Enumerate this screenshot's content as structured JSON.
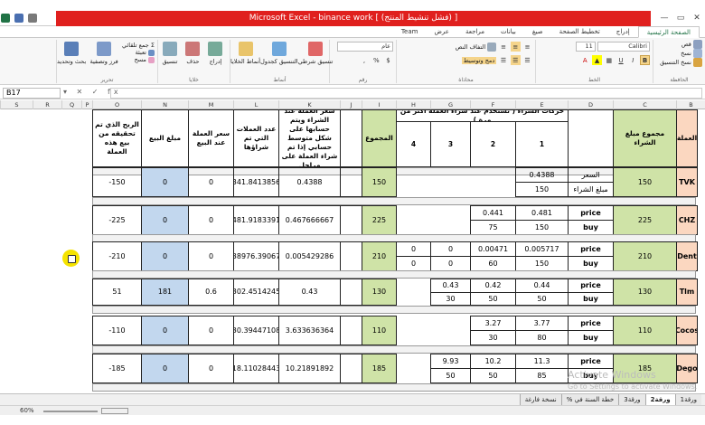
{
  "window": {
    "title": "Microsoft Excel - binance work  [ (فشل تنشيط المنتج) ]",
    "buttons": [
      "—",
      "▭",
      "✕"
    ]
  },
  "ribbon_tabs": [
    "الصفحة الرئيسية",
    "إدراج",
    "تخطيط الصفحة",
    "صيغ",
    "بيانات",
    "مراجعة",
    "عرض",
    "Team"
  ],
  "ribbon": {
    "clipboard": {
      "cut": "قص",
      "copy": "نسخ",
      "paste_format": "نسخ التنسيق",
      "label": "الحافظة"
    },
    "font": {
      "name": "Calibri",
      "size": "11",
      "bold": "B",
      "italic": "I",
      "underline": "U",
      "label": "الخط"
    },
    "alignment": {
      "wrap": "التفاف النص",
      "merge": "دمج وتوسيط",
      "label": "محاذاة"
    },
    "number": {
      "format": "عام",
      "label": "رقم"
    },
    "styles": {
      "conditional": "تنسيق شرطي",
      "as_table": "التنسيق كجدول",
      "cell_styles": "أنماط الخلايا",
      "label": "أنماط"
    },
    "cells": {
      "insert": "إدراج",
      "delete": "حذف",
      "format": "تنسيق",
      "label": "خلايا"
    },
    "editing": {
      "autosum": "جمع تلقائي",
      "fill": "تعبئة",
      "clear": "مسح",
      "sort": "فرز وتصفية",
      "find": "بحث وتحديد",
      "label": "تحرير"
    }
  },
  "formula_bar": {
    "name_box": "B17",
    "icons": "▾  ✕ ✓ fx",
    "formula": ""
  },
  "columns": [
    "B",
    "C",
    "D",
    "E",
    "F",
    "G",
    "H",
    "I",
    "J",
    "K",
    "L",
    "M",
    "N",
    "O",
    "P",
    "Q",
    "R",
    "S"
  ],
  "headers": {
    "currency": "العملة",
    "total_buy": "مجموع مبلغ الشراء",
    "movements": "حركات الشراء ( تستخدم عند شراء العملة أكثر من مرة )",
    "m1": "1",
    "m2": "2",
    "m3": "3",
    "m4": "4",
    "total": "المجموع",
    "avg_price": "سعر العملة عند الشراء ويتم حسابها على شكل متوسط حسابي إذا تم شراء العملة على مراحل",
    "coins": "عدد العملات التي تم شراؤها",
    "sell_price": "سعر العملة عند البيع",
    "sell_amount": "مبلغ البيع",
    "profit": "الربح الذي تم تحقيقه من بيع هذه العملة"
  },
  "rows": [
    {
      "name": "TVK",
      "total_buy": "150",
      "label_top": "السعر",
      "label_bottom": "مبلغ الشراء",
      "m1": [
        "0.4388",
        "150"
      ],
      "m2": [
        "",
        ""
      ],
      "m3": [
        "",
        ""
      ],
      "m4": [
        "",
        ""
      ],
      "sum": "150",
      "avg": "0.4388",
      "coins": "341.8413856",
      "sell_price": "0",
      "sell_amount": "0",
      "profit": "-150"
    },
    {
      "name": "CHZ",
      "total_buy": "225",
      "label_top": "price",
      "label_bottom": "buy",
      "m1": [
        "0.481",
        "150"
      ],
      "m2": [
        "0.441",
        "75"
      ],
      "m3": [
        "",
        ""
      ],
      "m4": [
        "",
        ""
      ],
      "sum": "225",
      "avg": "0.467666667",
      "coins": "481.9183391",
      "sell_price": "0",
      "sell_amount": "0",
      "profit": "-225"
    },
    {
      "name": "Dent",
      "total_buy": "210",
      "label_top": "price",
      "label_bottom": "buy",
      "m1": [
        "0.005717",
        "150"
      ],
      "m2": [
        "0.00471",
        "60"
      ],
      "m3": [
        "0",
        "0"
      ],
      "m4": [
        "0",
        "0"
      ],
      "sum": "210",
      "avg": "0.005429286",
      "coins": "38976.39067",
      "sell_price": "0",
      "sell_amount": "0",
      "profit": "-210"
    },
    {
      "name": "Tlm",
      "total_buy": "130",
      "label_top": "price",
      "label_bottom": "buy",
      "m1": [
        "0.44",
        "50"
      ],
      "m2": [
        "0.42",
        "50"
      ],
      "m3": [
        "0.43",
        "30"
      ],
      "m4": [
        "",
        ""
      ],
      "sum": "130",
      "avg": "0.43",
      "coins": "302.4514245",
      "sell_price": "0.6",
      "sell_amount": "181",
      "profit": "51"
    },
    {
      "name": "Cocos",
      "total_buy": "110",
      "label_top": "price",
      "label_bottom": "buy",
      "m1": [
        "3.77",
        "80"
      ],
      "m2": [
        "3.27",
        "30"
      ],
      "m3": [
        "",
        ""
      ],
      "m4": [
        "",
        ""
      ],
      "sum": "110",
      "avg": "3.633636364",
      "coins": "30.39447108",
      "sell_price": "0",
      "sell_amount": "0",
      "profit": "-110"
    },
    {
      "name": "Dego",
      "total_buy": "185",
      "label_top": "price",
      "label_bottom": "buy",
      "m1": [
        "11.3",
        "85"
      ],
      "m2": [
        "10.2",
        "50"
      ],
      "m3": [
        "9.93",
        "50"
      ],
      "m4": [
        "",
        ""
      ],
      "sum": "185",
      "avg": "10.21891892",
      "coins": "18.11028443",
      "sell_price": "0",
      "sell_amount": "0",
      "profit": "-185"
    }
  ],
  "sheet_tabs": [
    "ورقة1",
    "ورقة2",
    "ورقة3",
    "خطة السنة في %",
    "نسخة فارغة"
  ],
  "status": {
    "zoom": "60%"
  },
  "watermark": {
    "line1": "Activate Windows",
    "line2": "Go to Settings to activate Windows."
  }
}
